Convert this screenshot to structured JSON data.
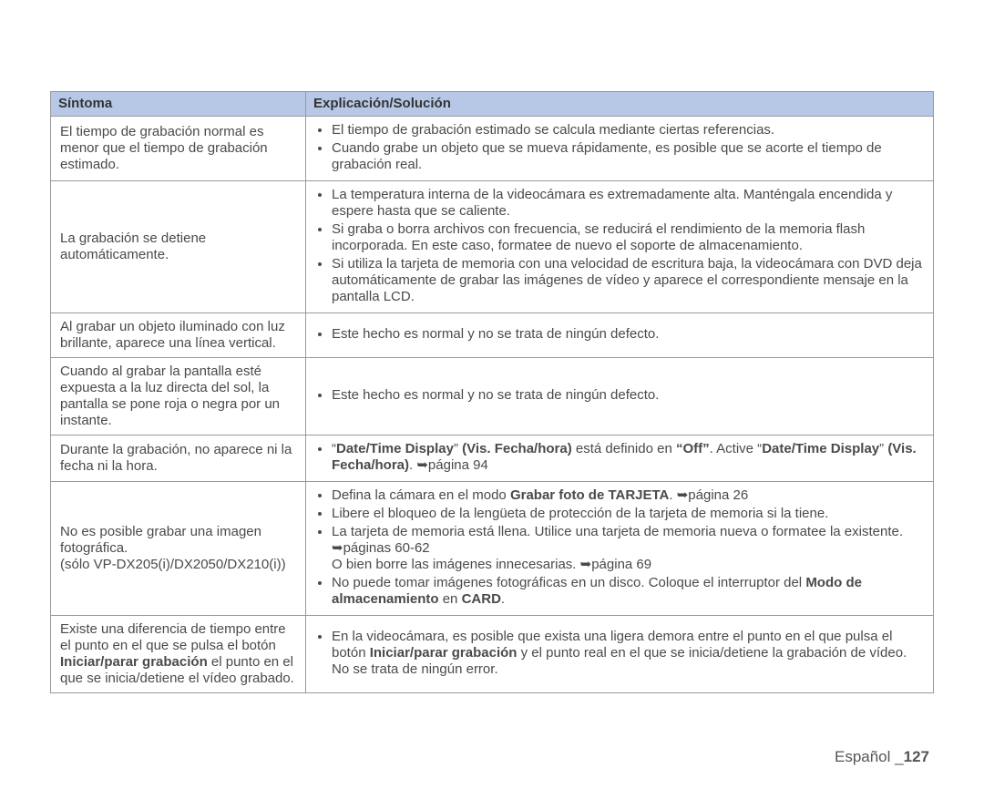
{
  "table": {
    "headers": {
      "symptom": "Síntoma",
      "explanation": "Explicación/Solución"
    },
    "rows": [
      {
        "symptom_html": "El tiempo de grabación normal es menor que el tiempo de grabación estimado.",
        "explain_items": [
          "El tiempo de grabación estimado se calcula mediante ciertas referencias.",
          "Cuando grabe un objeto que se mueva rápidamente, es posible que se acorte el tiempo de grabación real."
        ]
      },
      {
        "symptom_html": "La grabación se detiene automáticamente.",
        "explain_items": [
          "La temperatura interna de la videocámara es extremadamente alta. Manténgala encendida y espere hasta que se caliente.",
          "Si graba o borra archivos con frecuencia, se reducirá el rendimiento de la memoria flash incorporada. En este caso, formatee de nuevo el soporte de almacenamiento.",
          "Si utiliza la tarjeta de memoria con una velocidad de escritura baja, la videocámara con DVD deja automáticamente de grabar las imágenes de vídeo y aparece el correspondiente mensaje en la pantalla LCD."
        ]
      },
      {
        "symptom_html": "Al grabar un objeto iluminado con luz brillante, aparece una línea vertical.",
        "explain_items": [
          "Este hecho es normal y no se trata de ningún defecto."
        ]
      },
      {
        "symptom_html": "Cuando al grabar la pantalla esté expuesta a la luz directa del sol, la pantalla se pone roja o negra por un instante.",
        "explain_items": [
          "Este hecho es normal y no se trata de ningún defecto."
        ]
      },
      {
        "symptom_html": "Durante la grabación, no aparece ni la fecha ni la hora.",
        "explain_items": [
          "“<b>Date/Time Display</b>” <b>(Vis. Fecha/hora)</b> está definido en <b>“Off”</b>. Active “<b>Date/Time Display</b>” <b>(Vis. Fecha/hora)</b>. ➥página 94"
        ]
      },
      {
        "symptom_html": "No es posible grabar una imagen fotográfica.<br>(sólo VP-DX205(i)/DX2050/DX210(i))",
        "explain_items": [
          "Defina la cámara en el modo <b>Grabar foto de TARJETA</b>. ➥página 26",
          "Libere el bloqueo de la lengüeta de protección de la tarjeta de memoria si la tiene.",
          "La tarjeta de memoria está llena. Utilice una tarjeta de memoria nueva o formatee la existente. ➥páginas 60-62<br>O bien borre las imágenes innecesarias. ➥página 69",
          "No puede tomar imágenes fotográficas en un disco. Coloque el interruptor del <b>Modo de almacenamiento</b> en <b>CARD</b>."
        ]
      },
      {
        "symptom_html": "Existe una diferencia de tiempo entre el punto en el que se pulsa el botón <b>Iniciar/parar grabación</b> el punto en el que se inicia/detiene el vídeo grabado.",
        "explain_items": [
          "En la videocámara, es posible que exista una ligera demora entre el punto en el que pulsa el botón <b>Iniciar/parar grabación</b> y el punto real en el que se inicia/detiene la grabación de vídeo. No se trata de ningún error."
        ]
      }
    ]
  },
  "footer": {
    "language": "Español ",
    "divider": "_",
    "page": "127"
  }
}
